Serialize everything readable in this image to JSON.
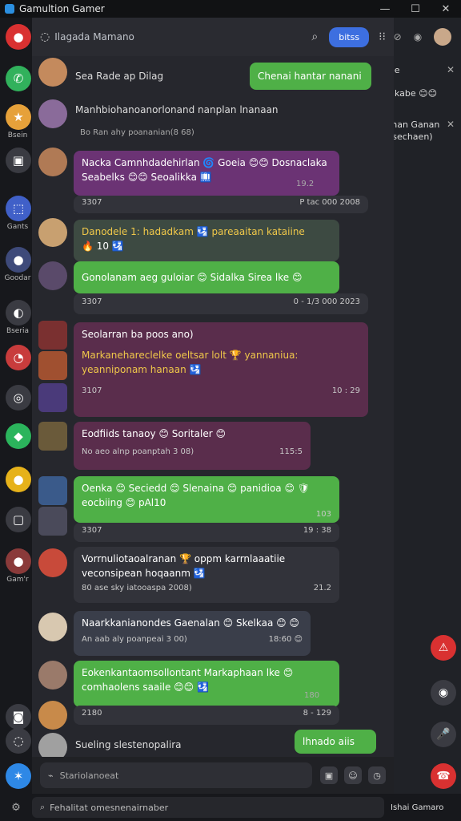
{
  "window": {
    "title": "Gamultion Gamer",
    "controls": [
      "—",
      "☐",
      "✕"
    ]
  },
  "header": {
    "name": "Ilagada Mamano",
    "button": "bitss"
  },
  "left_rail": [
    {
      "label": "",
      "color": "#d93131",
      "glyph": "●"
    },
    {
      "label": "",
      "color": "#31b15c",
      "glyph": "✆"
    },
    {
      "label": "Bsein",
      "color": "#e6a13a",
      "glyph": "★"
    },
    {
      "label": "",
      "color": "#3a3b42",
      "glyph": "▣"
    },
    {
      "label": "Gants",
      "color": "#4060c8",
      "glyph": "⬚"
    },
    {
      "label": "Goodar",
      "color": "#3e4a7a",
      "glyph": "●"
    },
    {
      "label": "Bseria",
      "color": "#3a3b42",
      "glyph": "◐"
    },
    {
      "label": "",
      "color": "#c83c3c",
      "glyph": "◔"
    },
    {
      "label": "",
      "color": "#3a3b42",
      "glyph": "◎"
    },
    {
      "label": "",
      "color": "#2bb45c",
      "glyph": "◆"
    },
    {
      "label": "",
      "color": "#e6b21a",
      "glyph": "●"
    },
    {
      "label": "",
      "color": "#3a3b42",
      "glyph": "▢"
    },
    {
      "label": "Gam'r",
      "color": "#8a3a3a",
      "glyph": "●"
    },
    {
      "label": "",
      "color": "#3a3b42",
      "glyph": "◙"
    },
    {
      "label": "",
      "color": "#3a3b42",
      "glyph": "◌"
    },
    {
      "label": "",
      "color": "#2e88e6",
      "glyph": "✶"
    }
  ],
  "right_panel": {
    "card1": "ae",
    "card1_emoji": "nkabe 😊😊",
    "card2": "Ihan Ganan",
    "card2_sub": "(sechaen)"
  },
  "messages": {
    "m1_left": "Sea Rade ap Dilag",
    "m1_right": "Chenai hantar nanani",
    "m2_line": "Manhbiohanoanorlonand nanplan lnanaan",
    "m2_sub": "Bo Ran ahy poananian(8 68)",
    "m3_text": "Nacka Camnhdadehirlan 🌀 Goeia 😊😊 Dosnaclaka Seabelks 😊😊 Seoalikka 🛄",
    "m3_time_left": "19.2",
    "m3_meta_left": "3307",
    "m3_meta_right": "P tac 000 2008",
    "m4_text": "Danodele 1: hadadkam 🛂 pareaaitan kataiine",
    "m4_sub": "🔥 10 🛂",
    "m5_text": "Gonolanam aeg guloiar 😊 Sidalka Sirea lke 😊",
    "m5_meta_left": "3307",
    "m5_meta_right": "0 - 1/3 000 2023",
    "m6_title": "Seolarran ba poos ano)",
    "m6_text": "Markanehareclelke oeltsar lolt 🏆 yannaniua: yeanniponam hanaan 🛂",
    "m6_meta_left": "3107",
    "m6_meta_right": "10 : 29",
    "m7_text": "Eodfiids tanaoy 😊 Soritaler 😊",
    "m7_sub": "No aeo alnp poanptah 3 08)",
    "m7_time": "115:5",
    "m8_text": "Oenka 😊 Seciedd 😊 Slenaina 😊 panidioa 😊 🛡 eocbiing 😊 pAl10",
    "m8_meta_left": "3307",
    "m8_meta_right": "19 : 38",
    "m8_time": "103",
    "m9_line1": "Vorrnuliotaoalranan 🏆 oppm karrnlaaatiie",
    "m9_line2": "veconsipean hoqaanm 🛂",
    "m9_meta": "80 ase sky iatooaspa 2008)",
    "m9_time": "21.2",
    "m10_text": "Naarkkanianondes Gaenalan 😊 Skelkaa 😊 😊",
    "m10_sub": "An aab aly poanpeai 3 00)",
    "m10_time": "18:60 😊",
    "m11_text": "Eokenkantaomsollontant Markaphaan lke 😊 comhaolens saaile 😊😊 🛂",
    "m11_meta_left": "2180",
    "m11_meta_right": "8 - 129",
    "m11_time": "180",
    "m12_left": "Sueling slestenopalira",
    "m12_right": "lhnado aiis"
  },
  "composer": {
    "placeholder": "Stariolanoeat"
  },
  "bottom": {
    "search": "Fehalitat omesnenairnaber",
    "status": "Ishai Gamaro"
  }
}
